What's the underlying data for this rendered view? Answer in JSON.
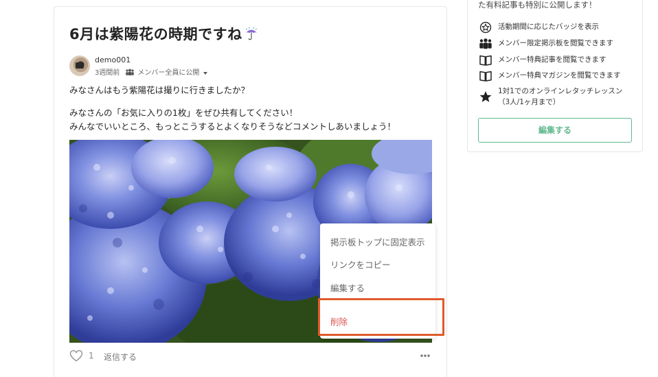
{
  "post": {
    "title": "6月は紫陽花の時期ですね",
    "author": "demo001",
    "time_ago": "3週間前",
    "visibility": "メンバー全員に公開",
    "body_line1": "みなさんはもう紫陽花は撮りに行きましたか？",
    "body_line2": "みなさんの「お気に入りの1枚」をぜひ共有してください！",
    "body_line3": "みんなでいいところ、もっとこうするとよくなりそうなどコメントしあいましょう！",
    "like_count": "1",
    "reply_label": "返信する",
    "icons": {
      "title_emoji": "umbrella-rain-icon",
      "visibility": "group-icon",
      "like": "heart-icon",
      "more": "more-dots-icon"
    }
  },
  "context_menu": {
    "items": [
      {
        "label": "掲示板トップに固定表示"
      },
      {
        "label": "リンクをコピー"
      },
      {
        "label": "編集する"
      }
    ],
    "delete_label": "削除",
    "delete_color": "#d9534f",
    "highlight_color": "#e05a2a"
  },
  "sidebar": {
    "top_text": "た有料記事も特別に公開します！",
    "benefits": [
      {
        "icon": "badge-star-icon",
        "label": "活動期間に応じたバッジを表示"
      },
      {
        "icon": "members-icon",
        "label": "メンバー限定掲示板を閲覧できます"
      },
      {
        "icon": "book-icon",
        "label": "メンバー特典記事を閲覧できます"
      },
      {
        "icon": "book-icon",
        "label": "メンバー特典マガジンを閲覧できます"
      },
      {
        "icon": "star-icon",
        "label": "1対1でのオンラインレタッチレッスン",
        "sub": "（3人/1ヶ月まで）"
      }
    ],
    "edit_button": "編集する",
    "accent_color": "#5fb88e"
  }
}
